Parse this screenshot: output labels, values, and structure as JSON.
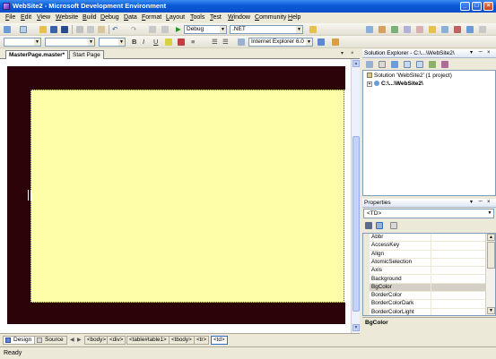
{
  "window": {
    "title": "WebSite2 - Microsoft Development Environment",
    "minimize": "_",
    "maximize": "□",
    "close": "×"
  },
  "menu": [
    "File",
    "Edit",
    "View",
    "Website",
    "Build",
    "Debug",
    "Data",
    "Format",
    "Layout",
    "Tools",
    "Test",
    "Window",
    "Community",
    "Help"
  ],
  "toolbar": {
    "config_value": "Debug",
    "platform_value": ".NET",
    "browser_target": "Internet Explorer 6.0"
  },
  "document_tabs": {
    "tabs": [
      "MasterPage.master*",
      "Start Page"
    ],
    "active_index": 0,
    "dropdown": "▾",
    "close": "×"
  },
  "designer": {
    "band_color": "#2c0308",
    "content_color": "#fefea8"
  },
  "view_buttons": [
    "Design",
    "Source"
  ],
  "breadcrumb": [
    "<body>",
    "<div>",
    "<table#table1>",
    "<tbody>",
    "<tr>",
    "<td>"
  ],
  "breadcrumb_selected": 5,
  "status": "Ready",
  "solution_explorer": {
    "title": "Solution Explorer - C:\\...\\WebSite2\\",
    "solution_label": "Solution 'WebSite2' (1 project)",
    "project_label": "C:\\...\\WebSite2\\"
  },
  "properties": {
    "title": "Properties",
    "object": "<TD>",
    "items": [
      "Abbr",
      "AccessKey",
      "Align",
      "AtomicSelection",
      "Axis",
      "Background",
      "BgColor",
      "BorderColor",
      "BorderColorDark",
      "BorderColorLight"
    ],
    "selected_index": 6,
    "description_title": "BgColor"
  },
  "colors": {
    "title_bar": "#0a5ad8",
    "chrome": "#ece9d8",
    "selection": "#316ac5"
  }
}
